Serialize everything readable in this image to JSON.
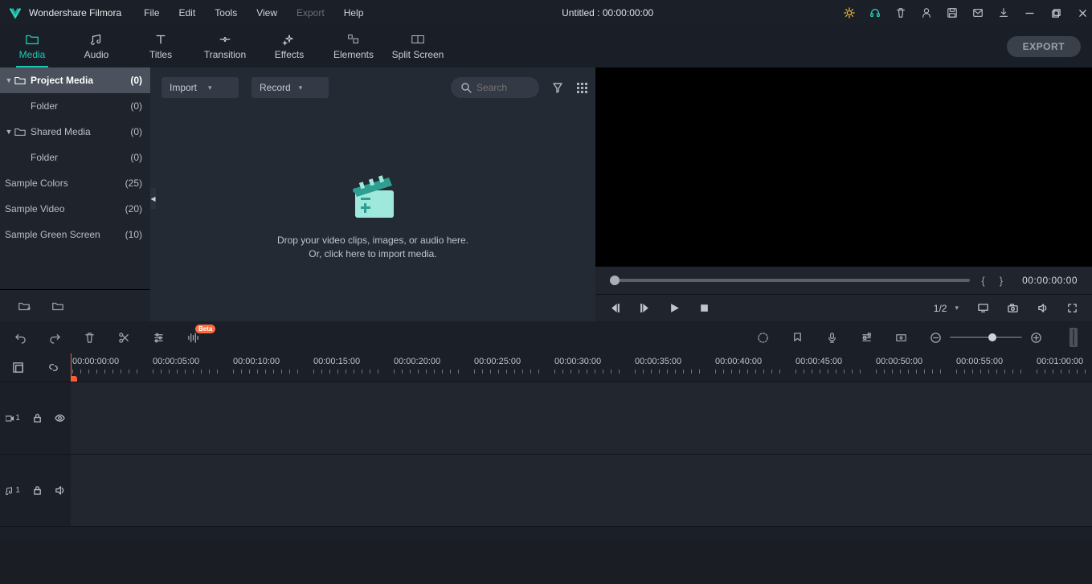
{
  "app": {
    "name": "Wondershare Filmora",
    "title": "Untitled : 00:00:00:00"
  },
  "menubar": [
    "File",
    "Edit",
    "Tools",
    "View",
    "Export",
    "Help"
  ],
  "menubar_dim_index": 4,
  "tabs": [
    {
      "id": "media",
      "label": "Media"
    },
    {
      "id": "audio",
      "label": "Audio"
    },
    {
      "id": "titles",
      "label": "Titles"
    },
    {
      "id": "transition",
      "label": "Transition"
    },
    {
      "id": "effects",
      "label": "Effects"
    },
    {
      "id": "elements",
      "label": "Elements"
    },
    {
      "id": "splitscreen",
      "label": "Split Screen"
    }
  ],
  "tabs_active": 0,
  "export_label": "EXPORT",
  "sidebar": {
    "items": [
      {
        "name": "Project Media",
        "count": "(0)",
        "sel": true,
        "caret": true,
        "folder": true,
        "indent": 0
      },
      {
        "name": "Folder",
        "count": "(0)",
        "sel": false,
        "caret": false,
        "folder": false,
        "indent": 1
      },
      {
        "name": "Shared Media",
        "count": "(0)",
        "sel": false,
        "caret": true,
        "folder": true,
        "indent": 0
      },
      {
        "name": "Folder",
        "count": "(0)",
        "sel": false,
        "caret": false,
        "folder": false,
        "indent": 1
      },
      {
        "name": "Sample Colors",
        "count": "(25)",
        "sel": false,
        "caret": false,
        "folder": false,
        "indent": 0,
        "noic": true
      },
      {
        "name": "Sample Video",
        "count": "(20)",
        "sel": false,
        "caret": false,
        "folder": false,
        "indent": 0,
        "noic": true
      },
      {
        "name": "Sample Green Screen",
        "count": "(10)",
        "sel": false,
        "caret": false,
        "folder": false,
        "indent": 0,
        "noic": true
      }
    ]
  },
  "mediabar": {
    "import_label": "Import",
    "record_label": "Record",
    "search_placeholder": "Search"
  },
  "dropzone": {
    "line1": "Drop your video clips, images, or audio here.",
    "line2": "Or, click here to import media."
  },
  "preview": {
    "timecode": "00:00:00:00",
    "ratio": "1/2"
  },
  "toolbar_badge": "Beta",
  "timeline": {
    "ticks": [
      "00:00:00:00",
      "00:00:05:00",
      "00:00:10:00",
      "00:00:15:00",
      "00:00:20:00",
      "00:00:25:00",
      "00:00:30:00",
      "00:00:35:00",
      "00:00:40:00",
      "00:00:45:00",
      "00:00:50:00",
      "00:00:55:00",
      "00:01:00:00"
    ],
    "track_v": "1",
    "track_a": "1"
  }
}
